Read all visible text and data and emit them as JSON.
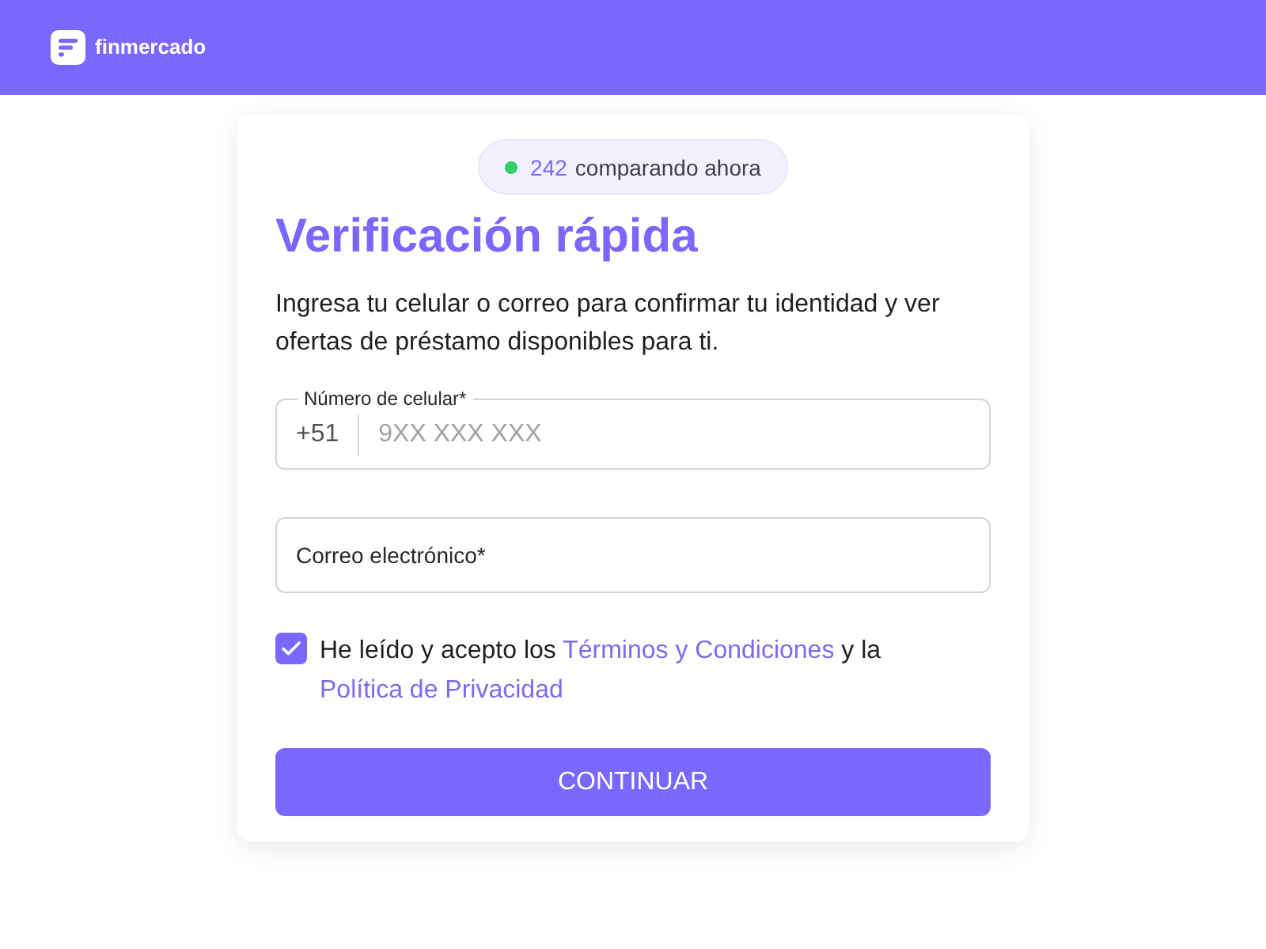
{
  "header": {
    "logo_text": "finmercado"
  },
  "card": {
    "live_badge": {
      "count": "242",
      "text": "comparando ahora"
    },
    "title": "Verificación rápida",
    "description": "Ingresa tu celular o correo para confirmar tu identidad y ver ofertas de préstamo disponibles para ti.",
    "phone_field": {
      "label": "Número de celular*",
      "prefix": "+51",
      "placeholder": "9XX XXX XXX"
    },
    "email_field": {
      "placeholder": "Correo electrónico*"
    },
    "consent": {
      "checked": true,
      "parts": [
        {
          "kind": "text",
          "text": "He leído y acepto los "
        },
        {
          "kind": "link",
          "text": "Términos y Condiciones"
        },
        {
          "kind": "text",
          "text": " y la "
        },
        {
          "kind": "link",
          "text": "Política de Privacidad"
        }
      ]
    },
    "submit_button": "CONTINUAR"
  }
}
